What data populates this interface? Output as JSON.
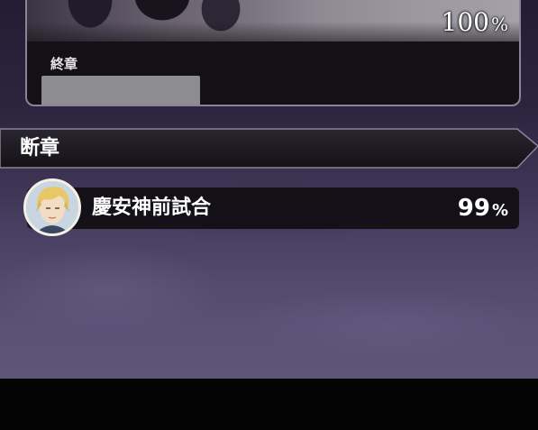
{
  "top_card": {
    "percent_value": "100",
    "percent_unit": "%",
    "chapter_label": "終章"
  },
  "section": {
    "title": "断章"
  },
  "chapter_item": {
    "title": "慶安神前試合",
    "percent_value": "99",
    "percent_unit": "%"
  },
  "colors": {
    "panel": "#141116",
    "border": "#8a8496",
    "text": "#ffffff"
  }
}
